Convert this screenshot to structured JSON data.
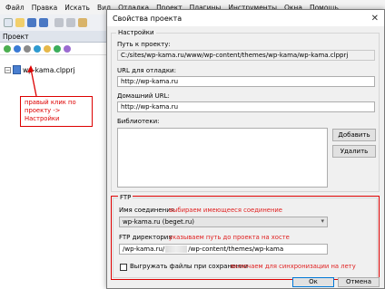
{
  "menu": [
    "Файл",
    "Правка",
    "Искать",
    "Вид",
    "Отладка",
    "Проект",
    "Плагины",
    "Инструменты",
    "Окна",
    "Помощь"
  ],
  "left_panel": {
    "title": "Проект",
    "tree_item_label": "wp-kama.clpprj",
    "expander": "−"
  },
  "annotations": {
    "right_click": "правый клик по проекту -> Настройки",
    "connection": "выбираем имеющееся соединение",
    "ftp_path": "указываем путь до проекта на хосте",
    "sync": "включаем для синхронизации на лету"
  },
  "dialog": {
    "title": "Свойства проекта",
    "close_glyph": "✕",
    "settings_group": "Настройки",
    "project_path_label": "Путь к проекту:",
    "project_path_value": "C:/sites/wp-kama.ru/www/wp-content/themes/wp-kama/wp-kama.clpprj",
    "debug_url_label": "URL для отладки:",
    "debug_url_value": "http://wp-kama.ru",
    "home_url_label": "Домашний URL:",
    "home_url_value": "http://wp-kama.ru",
    "libraries_label": "Библиотеки:",
    "add_button": "Добавить",
    "remove_button": "Удалить",
    "ftp_group": "FTP",
    "connection_label": "Имя соединения",
    "connection_value": "wp-kama.ru (beget.ru)",
    "ftp_dir_label": "FTP директория",
    "ftp_dir_prefix": "/wp-kama.ru/",
    "ftp_dir_suffix": "/wp-content/themes/wp-kama",
    "upload_on_save_label": "Выгружать файлы при сохранении",
    "ok_button": "Ок",
    "cancel_button": "Отмена"
  },
  "colors": {
    "annotation": "#dd0000",
    "dialog_bg": "#f0f0f0",
    "default_button_border": "#0078d7"
  }
}
